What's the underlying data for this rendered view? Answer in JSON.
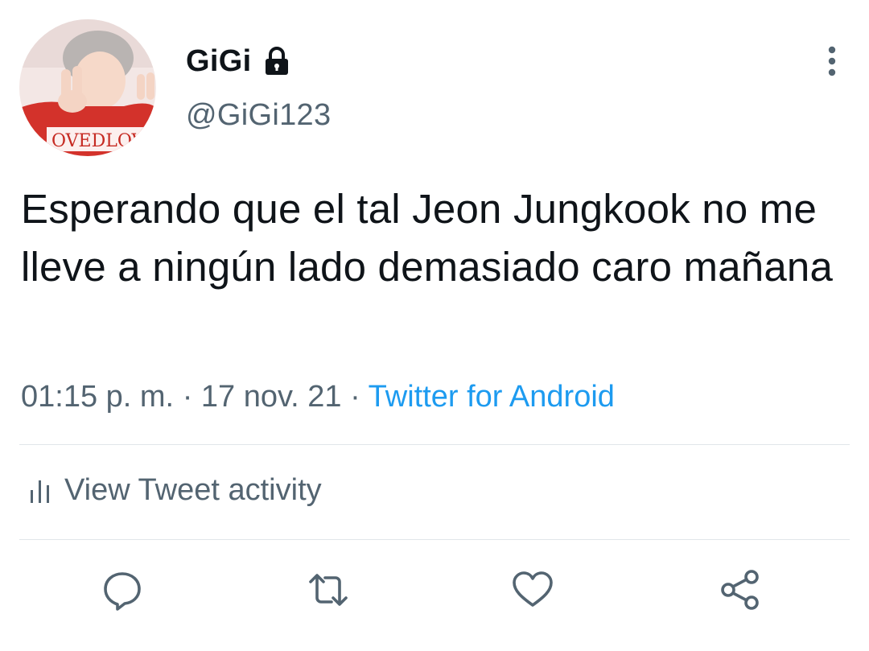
{
  "tweet": {
    "display_name": "GiGi",
    "handle": "@GiGi123",
    "text": "Esperando que el tal Jeon Jungkook no me lleve a ningún lado demasiado caro mañana",
    "time": "01:15 p. m.",
    "separator": "·",
    "date": "17 nov. 21",
    "source": "Twitter for Android",
    "activity_label": "View Tweet activity",
    "avatar_text": "OVEDLOVE"
  },
  "icons": {
    "lock": "lock-icon",
    "more": "more-vertical-icon",
    "activity": "bar-chart-icon",
    "reply": "reply-icon",
    "retweet": "retweet-icon",
    "like": "heart-icon",
    "share": "share-icon"
  },
  "colors": {
    "text": "#0f1419",
    "secondary": "#536471",
    "link": "#1d9bf0",
    "divider": "#e1e6ea"
  }
}
